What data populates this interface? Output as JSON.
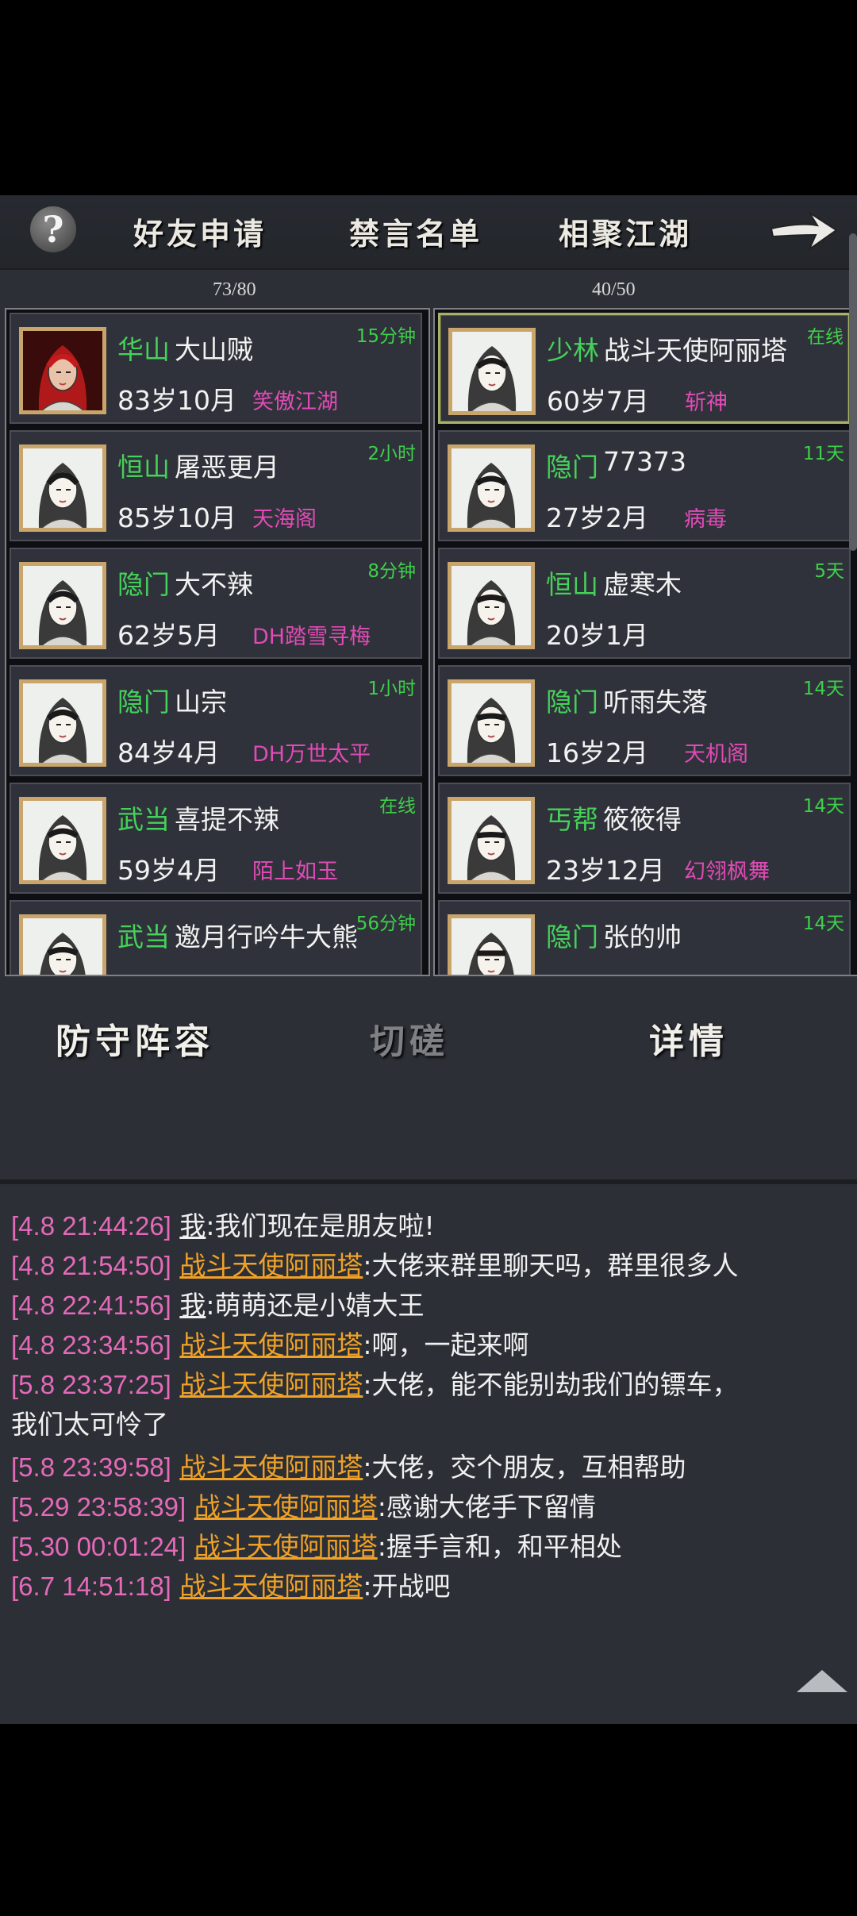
{
  "tabs": {
    "help": "?",
    "friend_requests": "好友申请",
    "mute_list": "禁言名单",
    "gather": "相聚江湖"
  },
  "left_count": "73/80",
  "right_count": "40/50",
  "left_friends": [
    {
      "sect": "华山",
      "name": "大山贼",
      "age": "83岁10月",
      "guild": "笑傲江湖",
      "time": "15分钟"
    },
    {
      "sect": "恒山",
      "name": "屠恶更月",
      "age": "85岁10月",
      "guild": "天海阁",
      "time": "2小时"
    },
    {
      "sect": "隐门",
      "name": "大不辣",
      "age": "62岁5月",
      "guild": "DH踏雪寻梅",
      "time": "8分钟"
    },
    {
      "sect": "隐门",
      "name": "山宗",
      "age": "84岁4月",
      "guild": "DH万世太平",
      "time": "1小时"
    },
    {
      "sect": "武当",
      "name": "喜提不辣",
      "age": "59岁4月",
      "guild": "陌上如玉",
      "time": "在线"
    },
    {
      "sect": "武当",
      "name": "邀月行吟牛大熊",
      "age": "",
      "guild": "",
      "time": "56分钟"
    }
  ],
  "right_friends": [
    {
      "sect": "少林",
      "name": "战斗天使阿丽塔",
      "age": "60岁7月",
      "guild": "斩神",
      "time": "在线"
    },
    {
      "sect": "隐门",
      "name": "77373",
      "age": "27岁2月",
      "guild": "病毒",
      "time": "11天"
    },
    {
      "sect": "恒山",
      "name": "虚寒木",
      "age": "20岁1月",
      "guild": "",
      "time": "5天"
    },
    {
      "sect": "隐门",
      "name": "听雨失落",
      "age": "16岁2月",
      "guild": "天机阁",
      "time": "14天"
    },
    {
      "sect": "丐帮",
      "name": "筱筱得",
      "age": "23岁12月",
      "guild": "幻翎枫舞",
      "time": "14天"
    },
    {
      "sect": "隐门",
      "name": "张的帅",
      "age": "",
      "guild": "",
      "time": "14天"
    }
  ],
  "actions": {
    "defense": "防守阵容",
    "spar": "切磋",
    "details": "详情"
  },
  "chat": [
    {
      "ts": "[4.8 21:44:26]",
      "who": "我",
      "self": true,
      "msg": ":我们现在是朋友啦!"
    },
    {
      "ts": "[4.8 21:54:50]",
      "who": "战斗天使阿丽塔",
      "self": false,
      "msg": ":大佬来群里聊天吗，群里很多人"
    },
    {
      "ts": "[4.8 22:41:56]",
      "who": "我",
      "self": true,
      "msg": ":萌萌还是小婧大王"
    },
    {
      "ts": "[4.8 23:34:56]",
      "who": "战斗天使阿丽塔",
      "self": false,
      "msg": ":啊，一起来啊"
    },
    {
      "ts": "[5.8 23:37:25]",
      "who": "战斗天使阿丽塔",
      "self": false,
      "msg": ":大佬，能不能别劫我们的镖车，"
    },
    {
      "ts": "",
      "who": "",
      "self": false,
      "msg": "我们太可怜了"
    },
    {
      "ts": "[5.8 23:39:58]",
      "who": "战斗天使阿丽塔",
      "self": false,
      "msg": ":大佬，交个朋友，互相帮助"
    },
    {
      "ts": "[5.29 23:58:39]",
      "who": "战斗天使阿丽塔",
      "self": false,
      "msg": ":感谢大佬手下留情"
    },
    {
      "ts": "[5.30 00:01:24]",
      "who": "战斗天使阿丽塔",
      "self": false,
      "msg": ":握手言和，和平相处"
    },
    {
      "ts": "[6.7 14:51:18]",
      "who": "战斗天使阿丽塔",
      "self": false,
      "msg": ":开战吧"
    }
  ]
}
